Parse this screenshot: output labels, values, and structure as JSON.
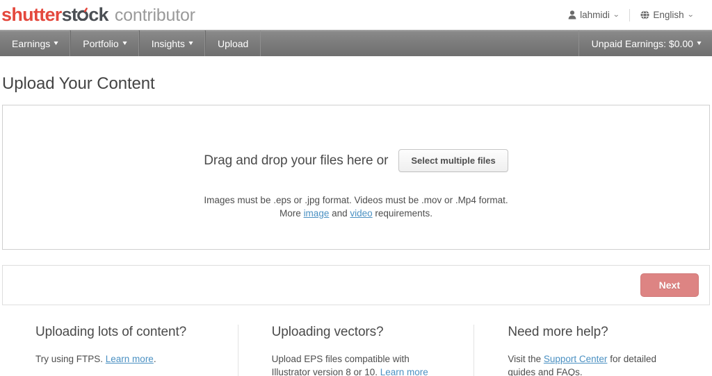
{
  "header": {
    "logo": {
      "brand_red": "shutter",
      "brand_dark_1": "st",
      "brand_dark_2": "ck",
      "product": "contributor",
      "color_red": "#e4483d",
      "color_dark": "#4b4f54",
      "color_product": "#9a9a9a"
    },
    "account": {
      "label": "lahmidi",
      "icon": "person-icon",
      "caret": "⌄"
    },
    "language": {
      "label": "English",
      "icon": "globe-icon",
      "caret": "⌄"
    }
  },
  "nav": {
    "items": [
      {
        "label": "Earnings",
        "has_caret": true
      },
      {
        "label": "Portfolio",
        "has_caret": true
      },
      {
        "label": "Insights",
        "has_caret": true
      },
      {
        "label": "Upload",
        "has_caret": false
      }
    ],
    "unpaid_earnings": {
      "label": "Unpaid Earnings: $0.00",
      "caret": "⌄"
    }
  },
  "main": {
    "page_title": "Upload Your Content",
    "dropzone": {
      "prompt": "Drag and drop your files here or",
      "select_button": "Select multiple files",
      "note_line1": "Images must be .eps or .jpg format. Videos must be .mov or .Mp4 format.",
      "note_more": "More ",
      "note_link_image": "image",
      "note_and": " and ",
      "note_link_video": "video",
      "note_tail": " requirements."
    },
    "next_button": {
      "label": "Next",
      "color": "#dd8483"
    }
  },
  "help": {
    "columns": [
      {
        "title": "Uploading lots of content?",
        "text_before": "Try using FTPS. ",
        "link": "Learn more",
        "text_after": "."
      },
      {
        "title": "Uploading vectors?",
        "text_before": "Upload EPS files compatible with Illustrator version 8 or 10. ",
        "link": "Learn more",
        "text_after": ""
      },
      {
        "title": "Need more help?",
        "text_before": "Visit the ",
        "link": "Support Center",
        "text_after": " for detailed guides and FAQs."
      }
    ]
  }
}
